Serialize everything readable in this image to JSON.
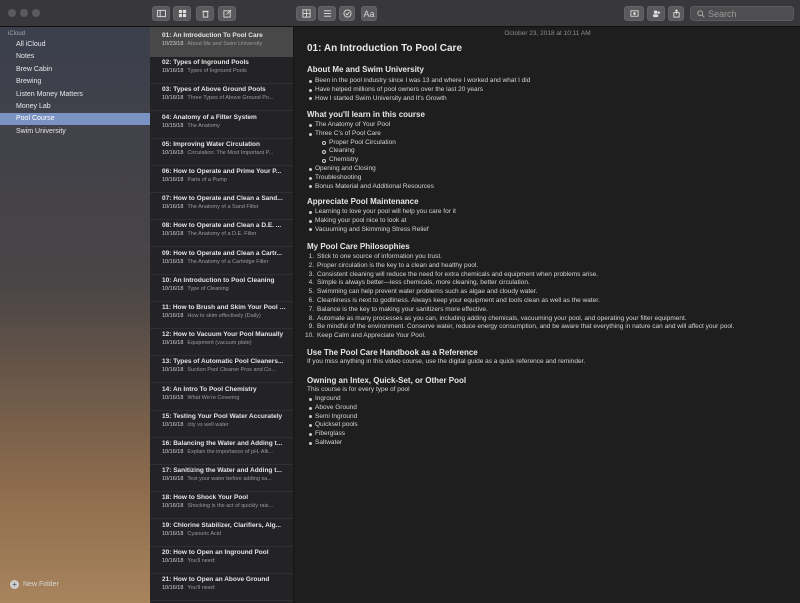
{
  "toolbar": {
    "attach_label": "Aa",
    "search_placeholder": "Search"
  },
  "sidebar": {
    "section_label": "iCloud",
    "items": [
      "All iCloud",
      "Notes",
      "Brew Cabin",
      "Brewing",
      "Listen Money Matters",
      "Money Lab",
      "Pool Course",
      "Swim University"
    ],
    "selected_index": 6,
    "new_folder_label": "New Folder"
  },
  "notes": [
    {
      "title": "01: An Introduction To Pool Care",
      "date": "10/23/18",
      "preview": "About Me and Swim University"
    },
    {
      "title": "02: Types of Inground Pools",
      "date": "10/16/18",
      "preview": "Types of Inground Pools"
    },
    {
      "title": "03: Types of Above Ground Pools",
      "date": "10/16/18",
      "preview": "Three Types of Above Ground Po..."
    },
    {
      "title": "04: Anatomy of a Filter System",
      "date": "10/15/18",
      "preview": "The Anatomy"
    },
    {
      "title": "05: Improving Water Circulation",
      "date": "10/16/18",
      "preview": "Circulation: The Most Important P..."
    },
    {
      "title": "06: How to Operate and Prime Your P...",
      "date": "10/16/18",
      "preview": "Parts of a Pump"
    },
    {
      "title": "07: How to Operate and Clean a Sand...",
      "date": "10/16/18",
      "preview": "The Anatomy of a Sand Filter"
    },
    {
      "title": "08: How to Operate and Clean a D.E. ...",
      "date": "10/16/18",
      "preview": "The Anatomy of a D.E. Filter"
    },
    {
      "title": "09: How to Operate and Clean a Cartr...",
      "date": "10/16/18",
      "preview": "The Anatomy of a Cartridge Filter"
    },
    {
      "title": "10: An Introduction to Pool Cleaning",
      "date": "10/16/18",
      "preview": "Type of Cleaning"
    },
    {
      "title": "11: How to Brush and Skim Your Pool L...",
      "date": "10/16/18",
      "preview": "How to skim effectively (Daily)"
    },
    {
      "title": "12: How to Vacuum Your Pool Manually",
      "date": "10/16/18",
      "preview": "Equipment (vacuum plate)"
    },
    {
      "title": "13: Types of Automatic Pool Cleaners...",
      "date": "10/16/18",
      "preview": "Suction Pool Cleaner Pros and Co..."
    },
    {
      "title": "14: An Intro To Pool Chemistry",
      "date": "10/16/18",
      "preview": "What We're Covering"
    },
    {
      "title": "15: Testing Your Pool Water Accurately",
      "date": "10/16/18",
      "preview": "city vs well water"
    },
    {
      "title": "16: Balancing the Water and Adding t...",
      "date": "10/16/18",
      "preview": "Explain the importance of pH, Alk..."
    },
    {
      "title": "17: Sanitizing the Water and Adding t...",
      "date": "10/16/18",
      "preview": "Test your water before adding sa..."
    },
    {
      "title": "18: How to Shock Your Pool",
      "date": "10/16/18",
      "preview": "Shocking is the act of quickly rais..."
    },
    {
      "title": "19: Chlorine Stabilizer, Clarifiers, Alg...",
      "date": "10/16/18",
      "preview": "Cyanuric Acid"
    },
    {
      "title": "20: How to Open an Inground Pool",
      "date": "10/16/18",
      "preview": "You'll need:"
    },
    {
      "title": "21: How to Open an Above Ground",
      "date": "10/16/18",
      "preview": "You'll need:"
    }
  ],
  "editor": {
    "date_line": "October 23, 2018 at 10:11 AM",
    "title": "01: An Introduction To Pool Care",
    "s1_heading": "About Me and Swim University",
    "s1_items": [
      "Been in the pool industry since I was 13 and where I worked and what I did",
      "Have helped millions of pool owners over the last 20 years",
      "How I started Swim University and It's Growth"
    ],
    "s2_heading": "What you'll learn in this course",
    "s2_items": [
      "The Anatomy of Your Pool",
      "Three C's of Pool Care"
    ],
    "s2_sub": [
      "Proper Pool Circulation",
      "Cleaning",
      "Chemistry"
    ],
    "s2_items_after": [
      "Opening and Closing",
      "Troubleshooting",
      "Bonus Material and Additional Resources"
    ],
    "s3_heading": "Appreciate Pool Maintenance",
    "s3_items": [
      "Learning to love your pool will help you care for it",
      "Making your pool nice to look at",
      "Vacuuming and Skimming Stress Relief"
    ],
    "s4_heading": "My Pool Care Philosophies",
    "s4_items": [
      "Stick to one source of information you trust.",
      "Proper circulation is the key to a clean and healthy pool.",
      "Consistent cleaning will reduce the need for extra chemicals and equipment when problems arise.",
      "Simple is always better—less chemicals, more cleaning, better circulation.",
      "Swimming can help prevent water problems such as algae and cloudy water.",
      "Cleanliness is next to godliness. Always keep your equipment and tools clean as well as the water.",
      "Balance is the key to making your sanitizers more effective.",
      "Automate as many processes as you can, including adding chemicals, vacuuming your pool, and operating your filter equipment.",
      "Be mindful of the environment. Conserve water, reduce energy consumption, and be aware that everything in nature can and will affect your pool.",
      "Keep Calm and Appreciate Your Pool."
    ],
    "s5_heading": "Use The Pool Care Handbook as a Reference",
    "s5_text": "If you miss anything in this video course, use the digital guide as a quick reference and reminder.",
    "s6_heading": "Owning an Intex, Quick-Set, or Other Pool",
    "s6_text": "This course is for every type of pool",
    "s6_items": [
      "Inground",
      "Above Ground",
      "Semi Inground",
      "Quickset pools",
      "Fiberglass",
      "Saltwater"
    ]
  }
}
